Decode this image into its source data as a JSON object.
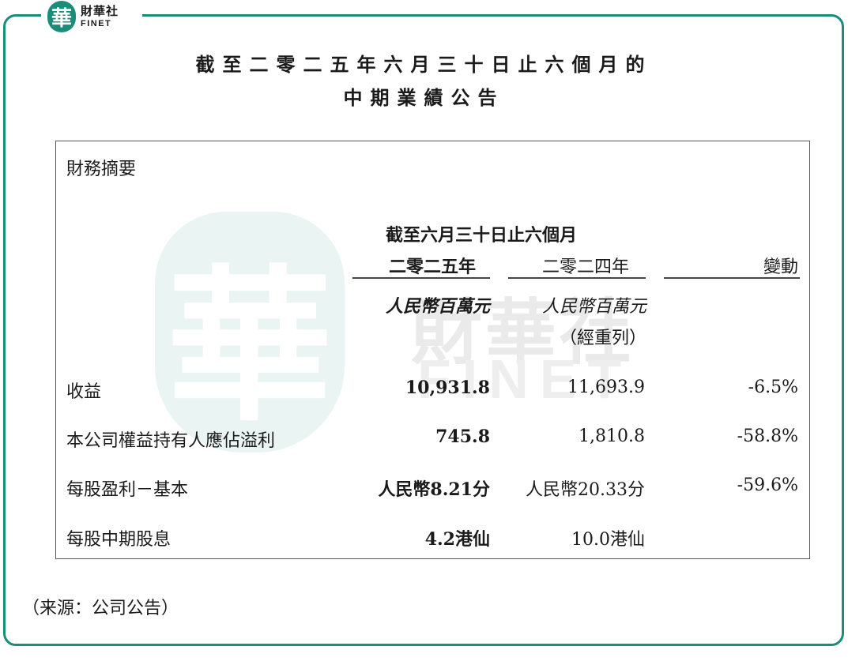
{
  "logo": {
    "mark": "華",
    "cn": "財華社",
    "en": "FINET"
  },
  "title": {
    "line1": "截至二零二五年六月三十日止六個月的",
    "line2": "中期業績公告"
  },
  "watermark": {
    "glyph": "華",
    "cn": "財華社",
    "en": "FINET"
  },
  "table": {
    "section_title": "財務摘要",
    "period_header": "截至六月三十日止六個月",
    "col_2025": "二零二五年",
    "col_2024": "二零二四年",
    "col_change": "變動",
    "unit_2025": "人民幣百萬元",
    "unit_2024": "人民幣百萬元",
    "restated": "（經重列）",
    "rows": [
      {
        "label": "收益",
        "v2025": "10,931.8",
        "v2024": "11,693.9",
        "change": "-6.5%"
      },
      {
        "label": "本公司權益持有人應佔溢利",
        "v2025": "745.8",
        "v2024": "1,810.8",
        "change": "-58.8%"
      },
      {
        "label": "每股盈利－基本",
        "v2025": "人民幣8.21分",
        "v2024": "人民幣20.33分",
        "change": "-59.6%"
      },
      {
        "label": "每股中期股息",
        "v2025": "4.2港仙",
        "v2024": "10.0港仙",
        "change": ""
      }
    ]
  },
  "source": "（来源：公司公告）",
  "colors": {
    "brand": "#1a8c7a"
  }
}
